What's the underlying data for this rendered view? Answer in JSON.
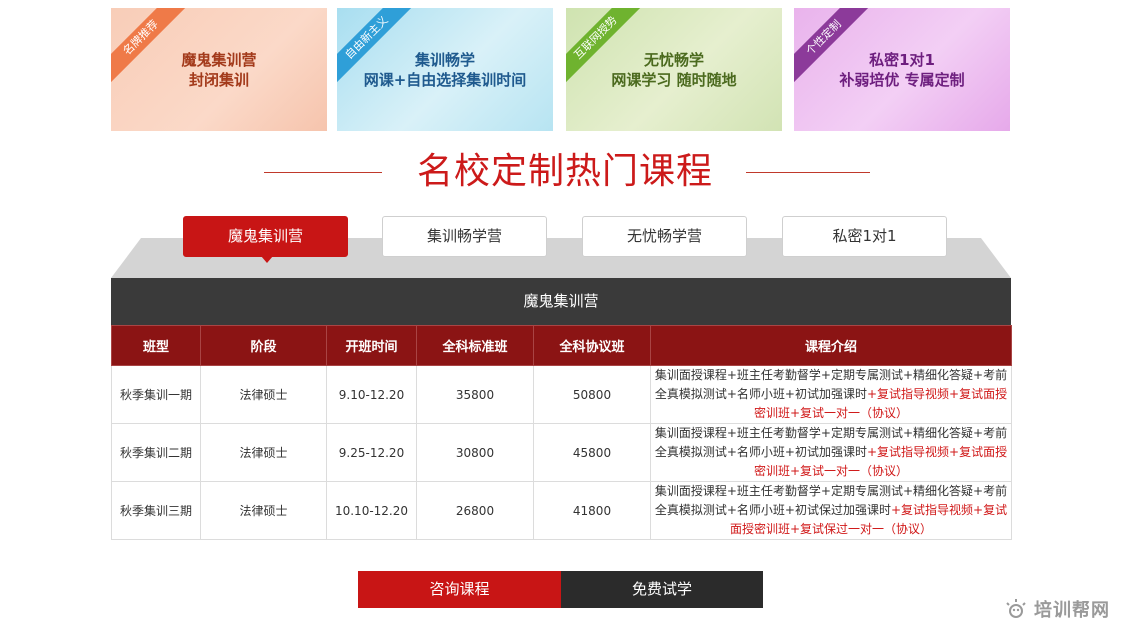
{
  "banners": [
    {
      "tag": "名牌推荐",
      "line1": "魔鬼集训营",
      "line2": "封闭集训"
    },
    {
      "tag": "自由新主义",
      "line1": "集训畅学",
      "line2": "网课+自由选择集训时间"
    },
    {
      "tag": "互联网授势",
      "line1": "无忧畅学",
      "line2": "网课学习 随时随地"
    },
    {
      "tag": "个性定制",
      "line1": "私密1对1",
      "line2": "补弱培优 专属定制"
    }
  ],
  "section_title": "名校定制热门课程",
  "tabs": [
    "魔鬼集训营",
    "集训畅学营",
    "无忧畅学营",
    "私密1对1"
  ],
  "table": {
    "title": "魔鬼集训营",
    "headers": [
      "班型",
      "阶段",
      "开班时间",
      "全科标准班",
      "全科协议班",
      "课程介绍"
    ],
    "rows": [
      {
        "type": "秋季集训一期",
        "stage": "法律硕士",
        "time": "9.10-12.20",
        "standard": "35800",
        "agreement": "50800",
        "intro_black": "集训面授课程+班主任考勤督学+定期专属测试+精细化答疑+考前全真模拟测试+名师小班+初试加强课时",
        "intro_red": "+复试指导视频+复试面授密训班+复试一对一（协议）"
      },
      {
        "type": "秋季集训二期",
        "stage": "法律硕士",
        "time": "9.25-12.20",
        "standard": "30800",
        "agreement": "45800",
        "intro_black": "集训面授课程+班主任考勤督学+定期专属测试+精细化答疑+考前全真模拟测试+名师小班+初试加强课时",
        "intro_red": "+复试指导视频+复试面授密训班+复试一对一（协议）"
      },
      {
        "type": "秋季集训三期",
        "stage": "法律硕士",
        "time": "10.10-12.20",
        "standard": "26800",
        "agreement": "41800",
        "intro_black": "集训面授课程+班主任考勤督学+定期专属测试+精细化答疑+考前全真模拟测试+名师小班+初试保过加强课时",
        "intro_red": "+复试指导视频+复试面授密训班+复试保过一对一（协议）"
      }
    ]
  },
  "buttons": {
    "consult": "咨询课程",
    "trial": "免费试学"
  },
  "watermark": "培训帮网"
}
